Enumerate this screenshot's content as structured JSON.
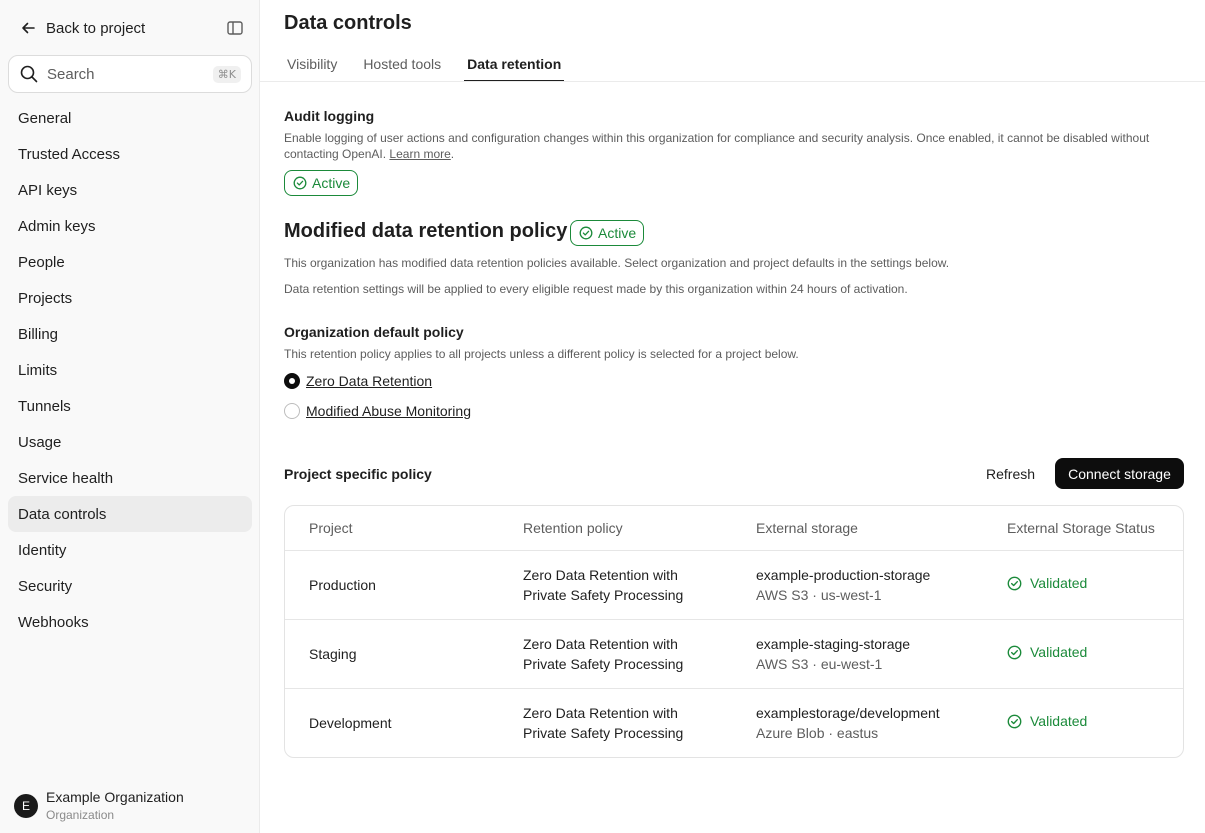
{
  "sidebar": {
    "back_label": "Back to project",
    "search": {
      "placeholder": "Search",
      "shortcut": "⌘K"
    },
    "items": [
      {
        "label": "General"
      },
      {
        "label": "Trusted Access"
      },
      {
        "label": "API keys"
      },
      {
        "label": "Admin keys"
      },
      {
        "label": "People"
      },
      {
        "label": "Projects"
      },
      {
        "label": "Billing"
      },
      {
        "label": "Limits"
      },
      {
        "label": "Tunnels"
      },
      {
        "label": "Usage"
      },
      {
        "label": "Service health"
      },
      {
        "label": "Data controls",
        "active": true
      },
      {
        "label": "Identity"
      },
      {
        "label": "Security"
      },
      {
        "label": "Webhooks"
      }
    ],
    "org": {
      "initial": "E",
      "name": "Example Organization",
      "role": "Organization"
    }
  },
  "header": {
    "title": "Data controls",
    "tabs": [
      {
        "label": "Visibility"
      },
      {
        "label": "Hosted tools"
      },
      {
        "label": "Data retention",
        "active": true
      }
    ]
  },
  "audit": {
    "title": "Audit logging",
    "description": "Enable logging of user actions and configuration changes within this organization for compliance and security analysis. Once enabled, it cannot be disabled without contacting OpenAI.",
    "learn_more": "Learn more",
    "period": ".",
    "badge": "Active"
  },
  "retention": {
    "title": "Modified data retention policy",
    "badge": "Active",
    "desc1": "This organization has modified data retention policies available. Select organization and project defaults in the settings below.",
    "desc2": "Data retention settings will be applied to every eligible request made by this organization within 24 hours of activation."
  },
  "org_policy": {
    "title": "Organization default policy",
    "description": "This retention policy applies to all projects unless a different policy is selected for a project below.",
    "options": [
      {
        "label": "Zero Data Retention",
        "selected": true
      },
      {
        "label": "Modified Abuse Monitoring",
        "selected": false
      }
    ]
  },
  "project_policy": {
    "title": "Project specific policy",
    "refresh_label": "Refresh",
    "connect_label": "Connect storage",
    "columns": [
      "Project",
      "Retention policy",
      "External storage",
      "External Storage Status"
    ],
    "rows": [
      {
        "project": "Production",
        "policy_line1": "Zero Data Retention with",
        "policy_line2": "Private Safety Processing",
        "storage": "example-production-storage",
        "storage_sub": "AWS S3 · us-west-1",
        "status": "Validated"
      },
      {
        "project": "Staging",
        "policy_line1": "Zero Data Retention with",
        "policy_line2": "Private Safety Processing",
        "storage": "example-staging-storage",
        "storage_sub": "AWS S3 · eu-west-1",
        "status": "Validated"
      },
      {
        "project": "Development",
        "policy_line1": "Zero Data Retention with",
        "policy_line2": "Private Safety Processing",
        "storage": "examplestorage/development",
        "storage_sub": "Azure Blob · eastus",
        "status": "Validated"
      }
    ]
  },
  "colors": {
    "accent": "#0d0d0d",
    "success": "#1b8a3a",
    "sidebar_bg": "#f9f9f9",
    "active_item_bg": "#ececec"
  }
}
